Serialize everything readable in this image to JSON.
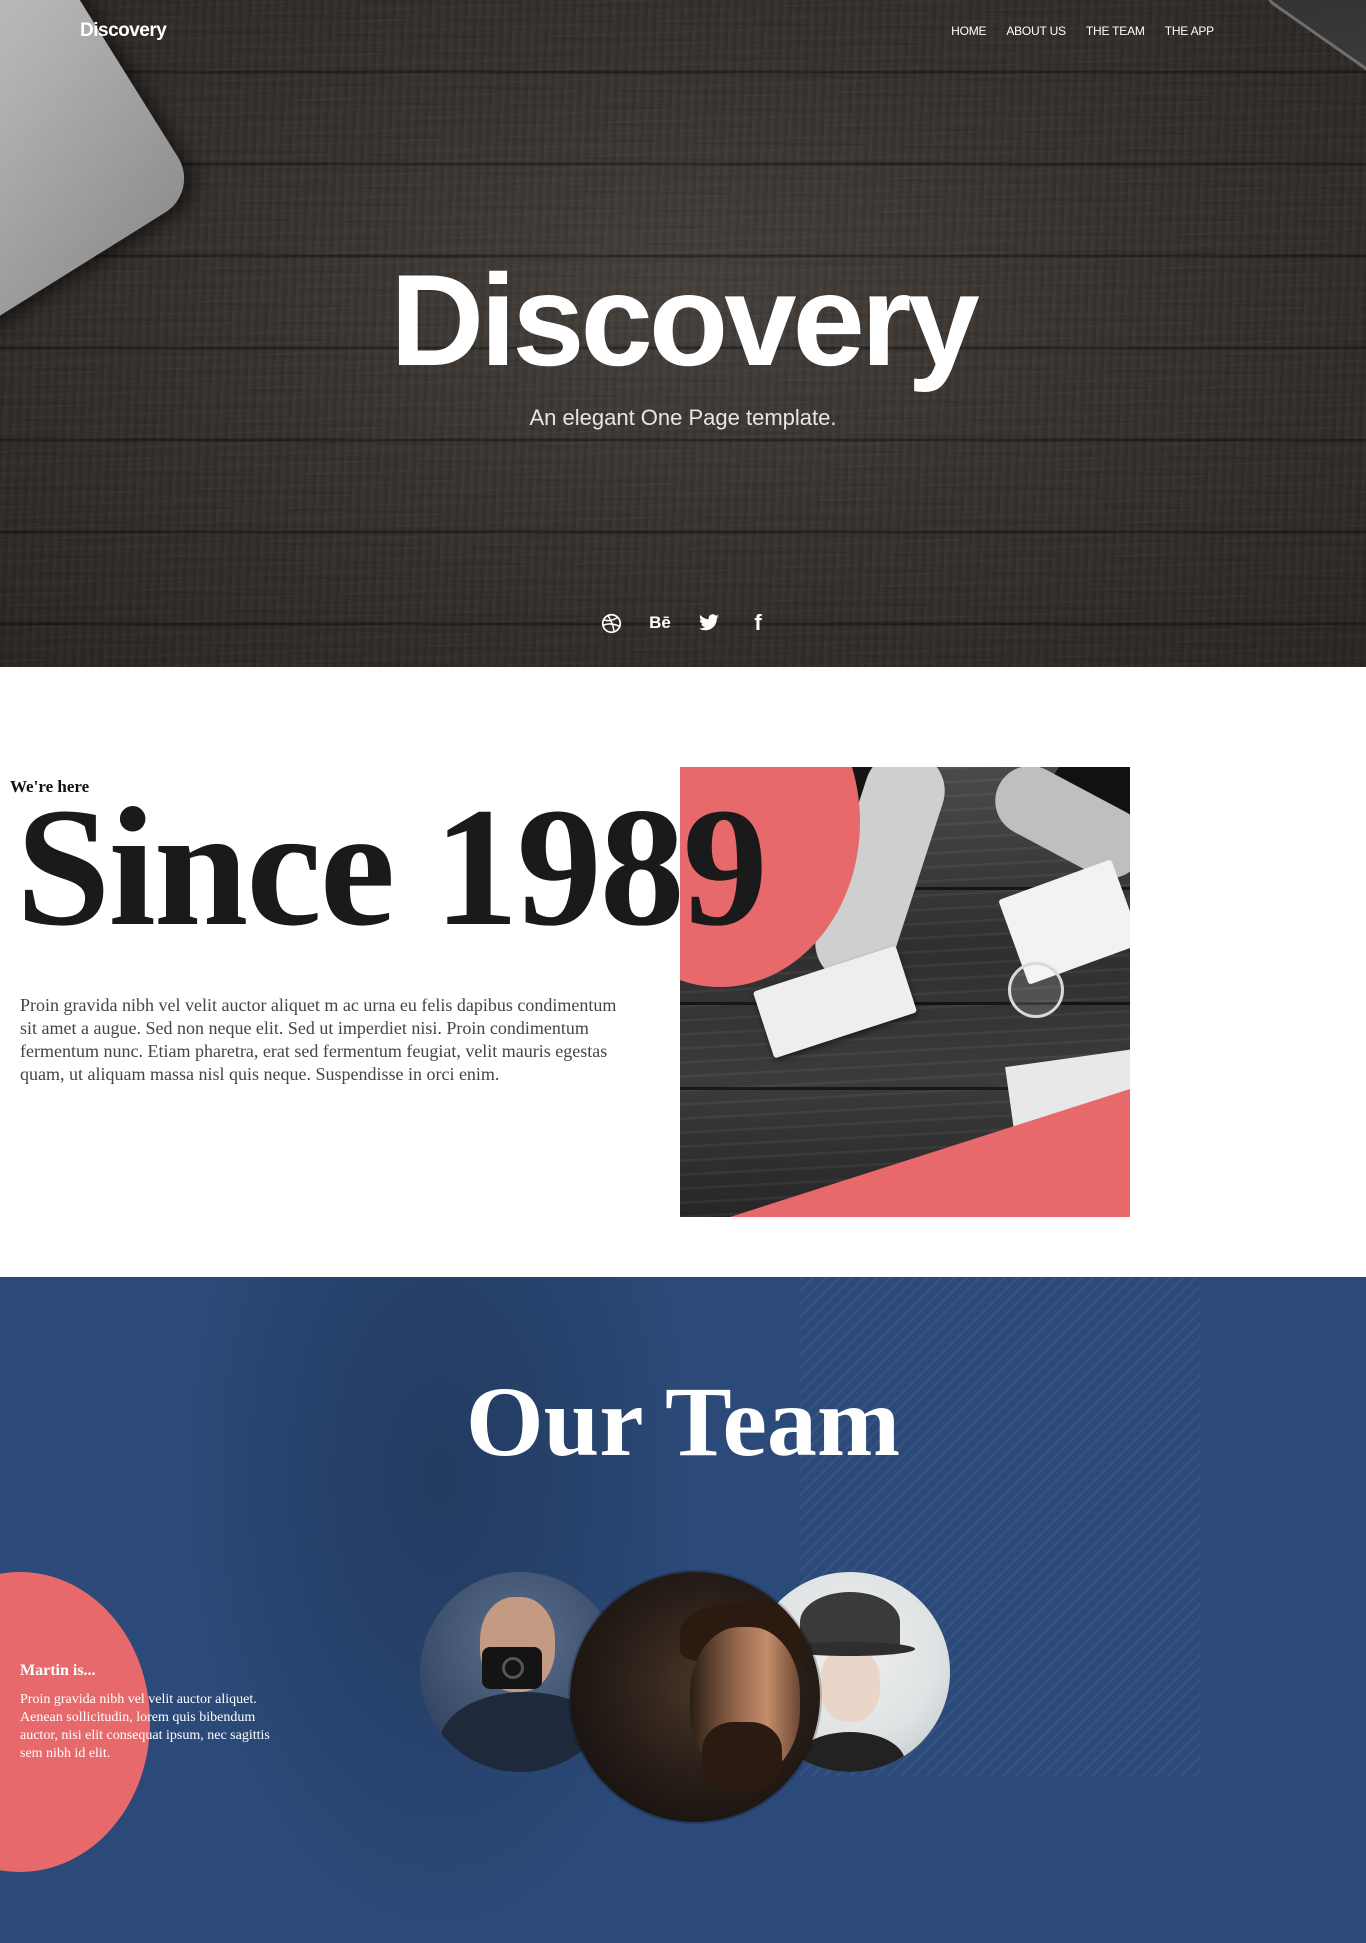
{
  "brand": "Discovery",
  "nav": {
    "items": [
      "HOME",
      "ABOUT US",
      "THE TEAM",
      "THE APP"
    ]
  },
  "hero": {
    "title": "Discovery",
    "subtitle": "An elegant One Page template."
  },
  "social": {
    "icons": [
      "dribbble-icon",
      "behance-icon",
      "twitter-icon",
      "facebook-icon"
    ],
    "behance_label": "Bē",
    "facebook_label": "f"
  },
  "about": {
    "kicker": "We're here",
    "headline": "Since 1989",
    "body": "Proin gravida nibh vel velit auctor aliquet m ac urna eu felis dapibus condimentum sit amet a augue. Sed non neque elit. Sed ut imperdiet nisi. Proin condimentum fermentum nunc. Etiam pharetra, erat sed fermentum feugiat, velit mauris egestas quam, ut aliquam massa nisl quis neque. Suspendisse in orci enim."
  },
  "team": {
    "title": "Our Team",
    "bio_name": "Martin is...",
    "bio_text": "Proin gravida nibh vel velit auctor aliquet. Aenean sollicitudin, lorem quis bibendum auctor, nisi elit consequat ipsum, nec sagittis sem nibh id elit."
  },
  "colors": {
    "accent": "#e8696b",
    "team_bg": "#2b4a79",
    "hero_bg": "#37322e"
  }
}
